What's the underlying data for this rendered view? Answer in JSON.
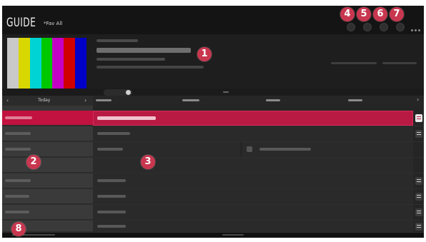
{
  "header": {
    "title": "GUIDE",
    "filter_label": "*Fav All"
  },
  "date_nav": {
    "prev_icon": "chevron-left-icon",
    "date_label": "Today",
    "next_icon": "chevron-right-icon"
  },
  "callouts": [
    "1",
    "2",
    "3",
    "4",
    "5",
    "6",
    "7",
    "8"
  ],
  "colorbars": [
    "#c9c9c9",
    "#d9d700",
    "#00d3d3",
    "#00c800",
    "#c400c4",
    "#d00000",
    "#0000c8"
  ],
  "colors": {
    "accent": "#c2123f",
    "callout": "#c8374f",
    "background": "#1b1b1b"
  },
  "rows_count_shown": 8,
  "selected_row": 0
}
